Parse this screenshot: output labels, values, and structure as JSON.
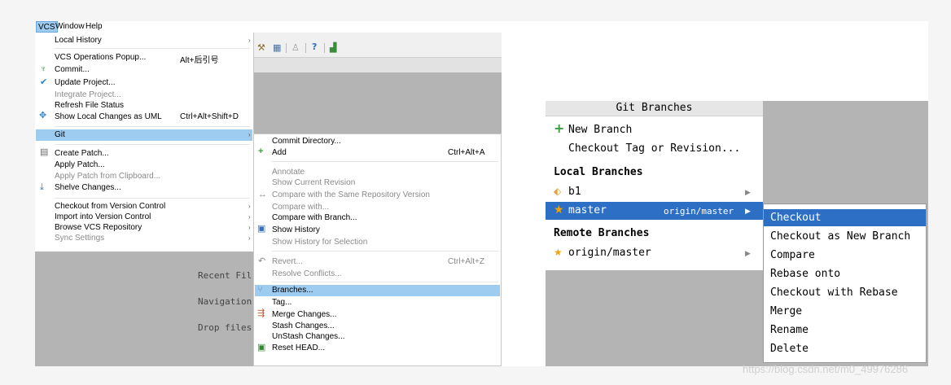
{
  "left": {
    "menubar": {
      "items": [
        "VCS",
        "Window",
        "Help"
      ]
    },
    "vcs_menu": {
      "local_history": "Local History",
      "ops_popup": "VCS Operations Popup...",
      "ops_popup_sc": "Alt+后引号",
      "commit": "Commit...",
      "update_project": "Update Project...",
      "integrate_project": "Integrate Project...",
      "refresh_status": "Refresh File Status",
      "show_uml": "Show Local Changes as UML",
      "show_uml_sc": "Ctrl+Alt+Shift+D",
      "git": "Git",
      "create_patch": "Create Patch...",
      "apply_patch": "Apply Patch...",
      "apply_patch_clip": "Apply Patch from Clipboard...",
      "shelve": "Shelve Changes...",
      "checkout_vc": "Checkout from Version Control",
      "import_vc": "Import into Version Control",
      "browse_repo": "Browse VCS Repository",
      "sync_settings": "Sync Settings"
    },
    "git_menu": {
      "commit_dir": "Commit Directory...",
      "add": "Add",
      "add_sc": "Ctrl+Alt+A",
      "annotate": "Annotate",
      "show_current_rev": "Show Current Revision",
      "compare_same": "Compare with the Same Repository Version",
      "compare_with": "Compare with...",
      "compare_branch": "Compare with Branch...",
      "show_history": "Show History",
      "show_history_sel": "Show History for Selection",
      "revert": "Revert...",
      "revert_sc": "Ctrl+Alt+Z",
      "resolve": "Resolve Conflicts...",
      "branches": "Branches...",
      "tag": "Tag...",
      "merge": "Merge Changes...",
      "stash": "Stash Changes...",
      "unstash": "UnStash Changes...",
      "reset_head": "Reset HEAD..."
    },
    "welcome": {
      "recent": "Recent Fil",
      "navigation": "Navigation",
      "drop": "Drop files"
    }
  },
  "right": {
    "popup": {
      "title": "Git Branches",
      "new_branch": "New Branch",
      "checkout_tag": "Checkout Tag or Revision...",
      "local_header": "Local Branches",
      "local": [
        {
          "name": "b1",
          "tracking": ""
        },
        {
          "name": "master",
          "tracking": "origin/master"
        }
      ],
      "remote_header": "Remote Branches",
      "remote": [
        {
          "name": "origin/master"
        }
      ]
    },
    "context_menu": {
      "items": [
        "Checkout",
        "Checkout as New Branch",
        "Compare",
        "Rebase onto",
        "Checkout with Rebase",
        "Merge",
        "Rename",
        "Delete"
      ],
      "selected": "Checkout"
    }
  },
  "watermark": "https://blog.csdn.net/m0_49976286",
  "colors": {
    "menu_highlight": "#9ecbf0",
    "popup_selection": "#2e6fc6",
    "ide_gray": "#b4b4b4",
    "new_branch_plus": "#3b9d3b",
    "star": "#f0a30a"
  }
}
